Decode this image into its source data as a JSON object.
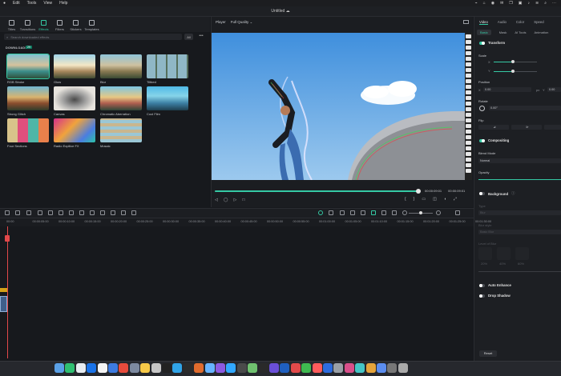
{
  "menubar": {
    "items": [
      "Edit",
      "Tools",
      "View",
      "Help"
    ],
    "right": [
      "⌁",
      "⌂",
      "◉",
      "✉",
      "❐",
      "▣",
      "♪",
      "≋",
      "⌕",
      "⋯"
    ]
  },
  "window": {
    "title": "Untitled",
    "title_icon": "cloud-icon"
  },
  "media_tabs": [
    {
      "label": "Titles",
      "icon": "titles-icon"
    },
    {
      "label": "Transitions",
      "icon": "transitions-icon"
    },
    {
      "label": "Effects",
      "icon": "effects-icon",
      "active": true
    },
    {
      "label": "Filters",
      "icon": "filters-icon"
    },
    {
      "label": "Stickers",
      "icon": "stickers-icon"
    },
    {
      "label": "Templates",
      "icon": "templates-icon"
    }
  ],
  "search": {
    "placeholder": "Search downloaded effects"
  },
  "filter_button": "All",
  "more_button": "•••",
  "downloads": {
    "label": "DOWNLOADS",
    "badge": "29"
  },
  "effects": [
    {
      "label": "RGB Stroke",
      "selected": true
    },
    {
      "label": "Glow"
    },
    {
      "label": "Blur"
    },
    {
      "label": "Tiltbed"
    },
    {
      "label": "Strong Glitch"
    },
    {
      "label": "Canvas"
    },
    {
      "label": "Chromatic Aberration"
    },
    {
      "label": "Cool Film"
    },
    {
      "label": "Four Sections"
    },
    {
      "label": "Radio Explilce FX"
    },
    {
      "label": "Mosaic"
    }
  ],
  "player": {
    "label": "Player",
    "quality": "Full Quality",
    "current": "00:00:09:01",
    "total": "00:00:09:01",
    "progress": 1.0
  },
  "inspector": {
    "tabs": [
      "Video",
      "Audio",
      "Color",
      "Speed"
    ],
    "active_tab": "Video",
    "subtabs": [
      "Basic",
      "Mask",
      "AI Tools",
      "Animation"
    ],
    "active_subtab": "Basic",
    "transform": {
      "label": "Transform",
      "enabled": true
    },
    "scale_label": "Scale",
    "scale_x": "X",
    "scale_y": "Y",
    "position_label": "Position",
    "pos_x_label": "X",
    "pos_x": "0.00",
    "pos_x_unit": "px",
    "pos_y_label": "Y",
    "pos_y": "0.00",
    "rotate_label": "Rotate",
    "rotate_value": "0.00°",
    "flip_label": "Flip",
    "compositing": {
      "label": "Compositing",
      "enabled": true
    },
    "blend_label": "Blend Mode",
    "blend_value": "Normal",
    "opacity_label": "Opacity",
    "background": {
      "label": "Background",
      "enabled": false
    },
    "bg_type_label": "Type",
    "bg_type_value": "Blur",
    "bg_style_label": "Blur style",
    "bg_style_value": "Basic Blur",
    "bg_level_label": "Level of Blur",
    "bg_levels": [
      "20%",
      "40%",
      "60%"
    ],
    "auto_enhance": {
      "label": "Auto Enhance",
      "enabled": false
    },
    "drop_shadow": {
      "label": "Drop Shadow",
      "enabled": false
    },
    "reset": "Reset"
  },
  "timeline": {
    "ruler": [
      "00:00",
      "00:00:05:00",
      "00:00:10:00",
      "00:00:15:00",
      "00:00:20:00",
      "00:00:25:00",
      "00:00:30:00",
      "00:00:35:00",
      "00:00:40:00",
      "00:00:45:00",
      "00:00:50:00",
      "00:00:55:00",
      "00:01:00:00",
      "00:01:05:00",
      "00:01:10:00",
      "00:01:15:00",
      "00:01:20:00",
      "00:01:25:00",
      "00:01:30:00"
    ]
  },
  "colors": {
    "accent": "#35c9a4",
    "playhead": "#e2484a",
    "bg": "#17191d",
    "panel": "#1d1f23"
  }
}
